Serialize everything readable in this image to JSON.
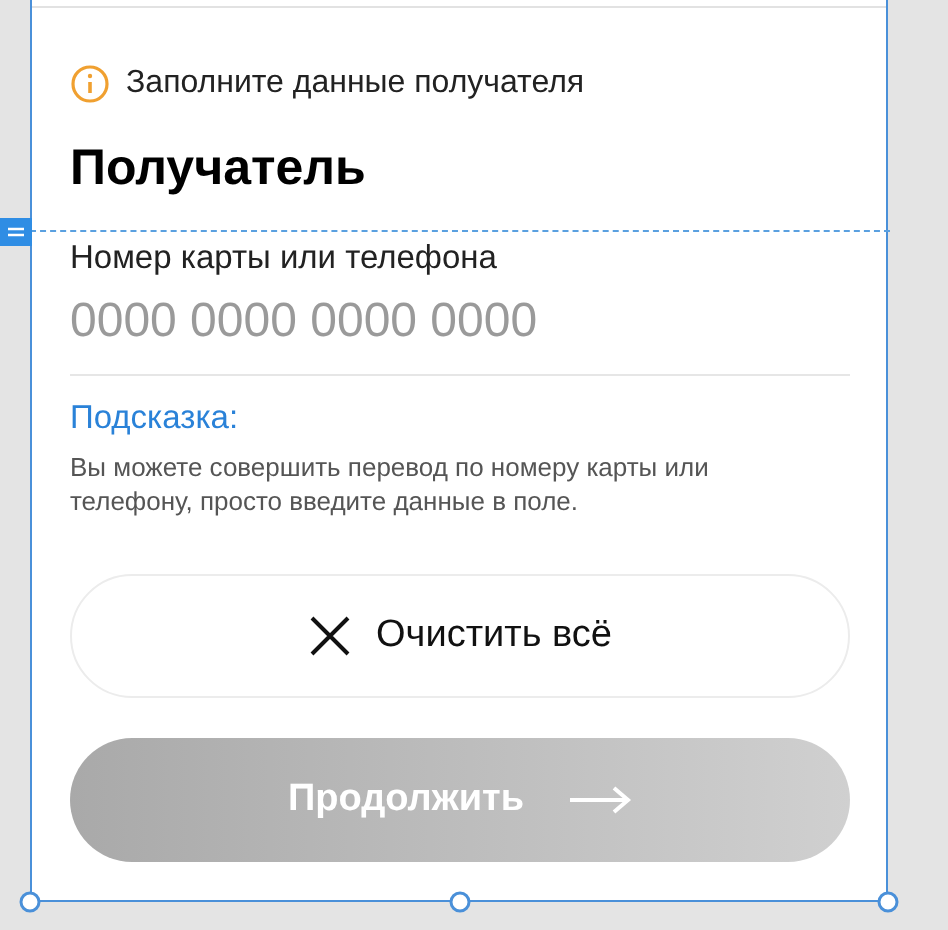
{
  "notice": {
    "text": "Заполните данные получателя"
  },
  "title": "Получатель",
  "field": {
    "label": "Номер карты или телефона",
    "placeholder": "0000 0000 0000 0000"
  },
  "hint": {
    "title": "Подсказка:",
    "text": "Вы можете совершить перевод по номеру карты или телефону, просто введите данные в поле."
  },
  "buttons": [
    {
      "kind": "clear",
      "label": "Очистить всё",
      "disabled": false
    },
    {
      "kind": "continue",
      "label": "Продолжить",
      "disabled": true
    }
  ]
}
